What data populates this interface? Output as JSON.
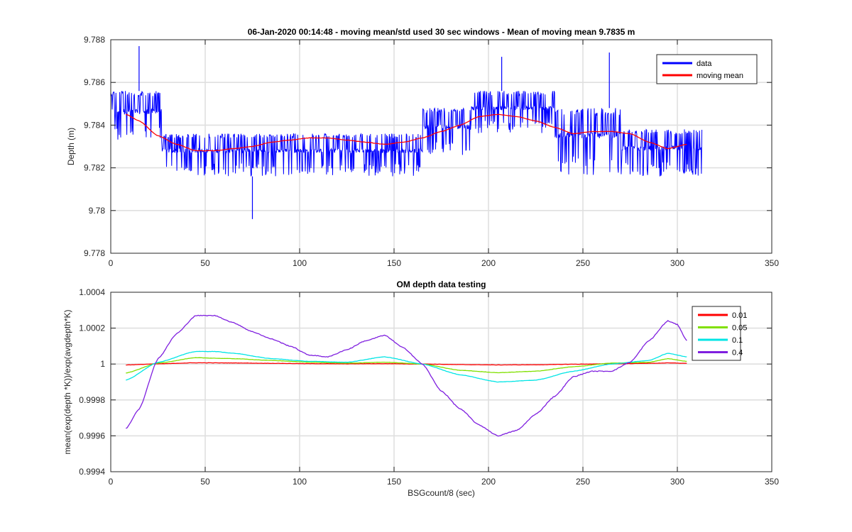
{
  "chart_data": [
    {
      "type": "line",
      "title": "06-Jan-2020 00:14:48 - moving mean/std used 30 sec windows - Mean of moving mean 9.7835 m",
      "xlabel": "",
      "ylabel": "Depth (m)",
      "xlim": [
        0,
        350
      ],
      "ylim": [
        9.778,
        9.788
      ],
      "xticks": [
        "0",
        "50",
        "100",
        "150",
        "200",
        "250",
        "300",
        "350"
      ],
      "yticks": [
        "9.778",
        "9.78",
        "9.782",
        "9.784",
        "9.786",
        "9.788"
      ],
      "grid": true,
      "legend_position": "top-right",
      "series": [
        {
          "name": "data",
          "color": "#0000ff",
          "style": "noisy band between quantized depth levels",
          "x_range": [
            0,
            313
          ],
          "band_segments": [
            {
              "x": [
                0,
                27
              ],
              "low": 9.7832,
              "high": 9.7856
            },
            {
              "x": [
                27,
                90
              ],
              "low": 9.7816,
              "high": 9.7836
            },
            {
              "x": [
                90,
                165
              ],
              "low": 9.7816,
              "high": 9.7836
            },
            {
              "x": [
                165,
                190
              ],
              "low": 9.7826,
              "high": 9.7848
            },
            {
              "x": [
                190,
                235
              ],
              "low": 9.7836,
              "high": 9.7856
            },
            {
              "x": [
                235,
                270
              ],
              "low": 9.7816,
              "high": 9.7848
            },
            {
              "x": [
                270,
                313
              ],
              "low": 9.7816,
              "high": 9.7838
            }
          ],
          "spikes": [
            {
              "x": 15,
              "y": 9.7877
            },
            {
              "x": 75,
              "y": 9.7796
            },
            {
              "x": 207,
              "y": 9.7872
            },
            {
              "x": 264,
              "y": 9.7874
            }
          ]
        },
        {
          "name": "moving mean",
          "color": "#ff0000",
          "x": [
            8,
            15,
            25,
            35,
            45,
            55,
            65,
            75,
            85,
            95,
            105,
            115,
            125,
            135,
            145,
            155,
            165,
            175,
            185,
            195,
            205,
            215,
            225,
            235,
            245,
            255,
            265,
            275,
            285,
            295,
            305
          ],
          "y": [
            9.7845,
            9.7842,
            9.7835,
            9.7831,
            9.7828,
            9.7828,
            9.7829,
            9.783,
            9.7832,
            9.7833,
            9.7834,
            9.7834,
            9.7833,
            9.7832,
            9.7831,
            9.7832,
            9.7834,
            9.7837,
            9.784,
            9.7844,
            9.7845,
            9.7844,
            9.7842,
            9.7839,
            9.7836,
            9.7837,
            9.7837,
            9.7836,
            9.7832,
            9.7829,
            9.7831
          ]
        }
      ]
    },
    {
      "type": "line",
      "title": "OM depth data testing",
      "xlabel": "BSGcount/8 (sec)",
      "ylabel": "mean(exp(depth *K))/exp(avgdepth*K)",
      "xlim": [
        0,
        350
      ],
      "ylim": [
        0.9994,
        1.0004
      ],
      "xticks": [
        "0",
        "50",
        "100",
        "150",
        "200",
        "250",
        "300",
        "350"
      ],
      "yticks": [
        "0.9994",
        "0.9996",
        "0.9998",
        "1",
        "1.0002",
        "1.0004"
      ],
      "grid": true,
      "legend_position": "top-right",
      "series": [
        {
          "name": "0.01",
          "color": "#ff0000",
          "x": [
            8,
            25,
            45,
            65,
            85,
            105,
            125,
            145,
            165,
            185,
            205,
            225,
            245,
            265,
            285,
            295,
            305
          ],
          "y": [
            0.999995,
            1.000001,
            1.000007,
            1.000006,
            1.000004,
            1.000002,
            1.000001,
            1.000002,
            1.0,
            0.999997,
            0.999995,
            0.999996,
            0.999999,
            1.000001,
            1.000004,
            1.000006,
            1.000004
          ]
        },
        {
          "name": "0.05",
          "color": "#80e000",
          "x": [
            8,
            25,
            45,
            65,
            85,
            105,
            125,
            145,
            165,
            185,
            205,
            225,
            245,
            265,
            285,
            295,
            305
          ],
          "y": [
            0.99995,
            1.000005,
            1.000035,
            1.00003,
            1.00002,
            1.00001,
            1.000005,
            1.00001,
            1.0,
            0.999965,
            0.999952,
            0.99996,
            0.999985,
            1.000005,
            1.00001,
            1.00003,
            1.000015
          ]
        },
        {
          "name": "0.1",
          "color": "#00e5e5",
          "x": [
            8,
            25,
            45,
            55,
            65,
            85,
            105,
            125,
            145,
            165,
            185,
            205,
            225,
            245,
            265,
            285,
            295,
            305
          ],
          "y": [
            0.99991,
            1.00001,
            1.00007,
            1.00007,
            1.00006,
            1.00003,
            1.000015,
            1.00001,
            1.00004,
            1.0,
            0.99994,
            0.9999,
            0.99991,
            0.99996,
            1.0,
            1.00002,
            1.00006,
            1.00004
          ]
        },
        {
          "name": "0.4",
          "color": "#7f1fdf",
          "x": [
            8,
            15,
            25,
            35,
            45,
            55,
            65,
            75,
            85,
            95,
            105,
            115,
            125,
            135,
            145,
            155,
            165,
            175,
            185,
            195,
            205,
            215,
            225,
            235,
            245,
            255,
            265,
            275,
            285,
            295,
            300,
            305
          ],
          "y": [
            0.99964,
            0.99975,
            1.00003,
            1.00017,
            1.00027,
            1.00027,
            1.00023,
            1.00018,
            1.00014,
            1.0001,
            1.00005,
            1.00004,
            1.00008,
            1.00013,
            1.00016,
            1.00009,
            1.0,
            0.99985,
            0.99975,
            0.99966,
            0.9996,
            0.99963,
            0.99972,
            0.99982,
            0.99993,
            0.99996,
            0.99996,
            1.00001,
            1.00013,
            1.00024,
            1.00022,
            1.00013
          ]
        }
      ]
    }
  ]
}
